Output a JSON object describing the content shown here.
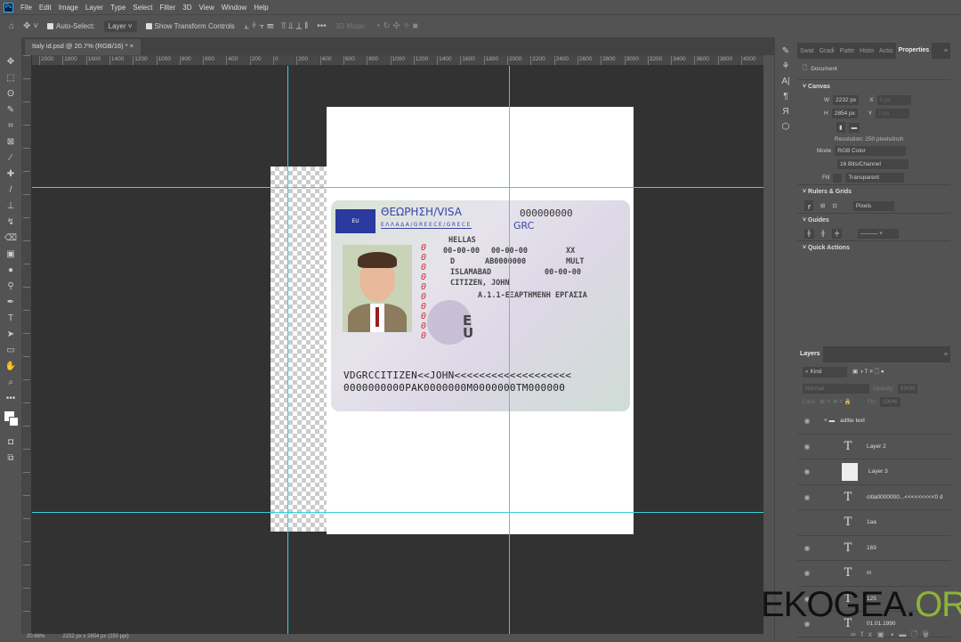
{
  "menu": [
    "File",
    "Edit",
    "Image",
    "Layer",
    "Type",
    "Select",
    "Filter",
    "3D",
    "View",
    "Window",
    "Help"
  ],
  "options": {
    "auto_select": "Auto-Select:",
    "auto_select_target": "Layer",
    "show_transform": "Show Transform Controls",
    "mode_3d": "3D Mode:"
  },
  "doc_tab": "Italy id.psd @ 20.7% (RGB/16) *",
  "ruler_labels": [
    "2000",
    "1800",
    "1600",
    "1400",
    "1200",
    "1000",
    "800",
    "600",
    "400",
    "200",
    "0",
    "200",
    "400",
    "600",
    "800",
    "1000",
    "1200",
    "1400",
    "1600",
    "1800",
    "2000",
    "2200",
    "2400",
    "2600",
    "2800",
    "3000",
    "3200",
    "3400",
    "3600",
    "3800",
    "4000",
    "4200"
  ],
  "card": {
    "flag": "EU",
    "title": "ΘΕΩΡΗΣΗ/VISA",
    "number": "000000000",
    "country": "ΕΛΛΑΔΑ/GREECE/GRECE",
    "code": "GRC",
    "fields": [
      "HELLAS",
      "00-00-00",
      "00-00-00",
      "XX",
      "D",
      "AB0000000",
      "MULT",
      "ISLAMABAD",
      "00-00-00",
      "CITIZEN, JOHN",
      "A.1.1-ΕΞΑΡΤΗΜΕΝΗ ΕΡΓΑΣΙΑ"
    ],
    "red_number": "0000000000",
    "eu_mark": "EU",
    "mrz1": "VDGRCCITIZEN<<JOHN<<<<<<<<<<<<<<<<<<<",
    "mrz2": "0000000000PAK0000000M0000000TM000000"
  },
  "properties": {
    "tabs": [
      "Swat",
      "Gradi",
      "Patte",
      "Histo",
      "Actio",
      "Properties"
    ],
    "document": "Document",
    "canvas": "Canvas",
    "w_label": "W",
    "w": "2232 px",
    "h_label": "H",
    "h": "2854 px",
    "x_label": "X",
    "x": "0 px",
    "y_label": "Y",
    "y": "0 px",
    "resolution": "Resolution: 250 pixels/inch",
    "mode_label": "Mode",
    "mode": "RGB Color",
    "depth": "16 Bits/Channel",
    "fill_label": "Fill",
    "fill": "Transparent",
    "rulers": "Rulers & Grids",
    "units": "Pixels",
    "guides": "Guides",
    "quick": "Quick Actions"
  },
  "layers": {
    "title": "Layers",
    "kind": "Kind",
    "blend": "Normal",
    "opacity_label": "Opacity:",
    "opacity": "100%",
    "lock": "Lock:",
    "fill_label": "Fill:",
    "fill": "100%",
    "group": "adlite text",
    "items": [
      {
        "name": "Layer 2",
        "type": "text"
      },
      {
        "name": "Layer 3",
        "type": "image"
      },
      {
        "name": "citla0000000...<<<<<<<<<0 d",
        "type": "text"
      },
      {
        "name": "1aa",
        "type": "text"
      },
      {
        "name": "169",
        "type": "text"
      },
      {
        "name": "m",
        "type": "text"
      },
      {
        "name": "125",
        "type": "text"
      },
      {
        "name": "01.01.1990",
        "type": "text"
      }
    ]
  },
  "status": {
    "zoom": "20.66%",
    "info": "2232 px x 2854 px (250 ppi)"
  },
  "watermark": {
    "a": "EKOGEA.",
    "b": "ORG"
  }
}
